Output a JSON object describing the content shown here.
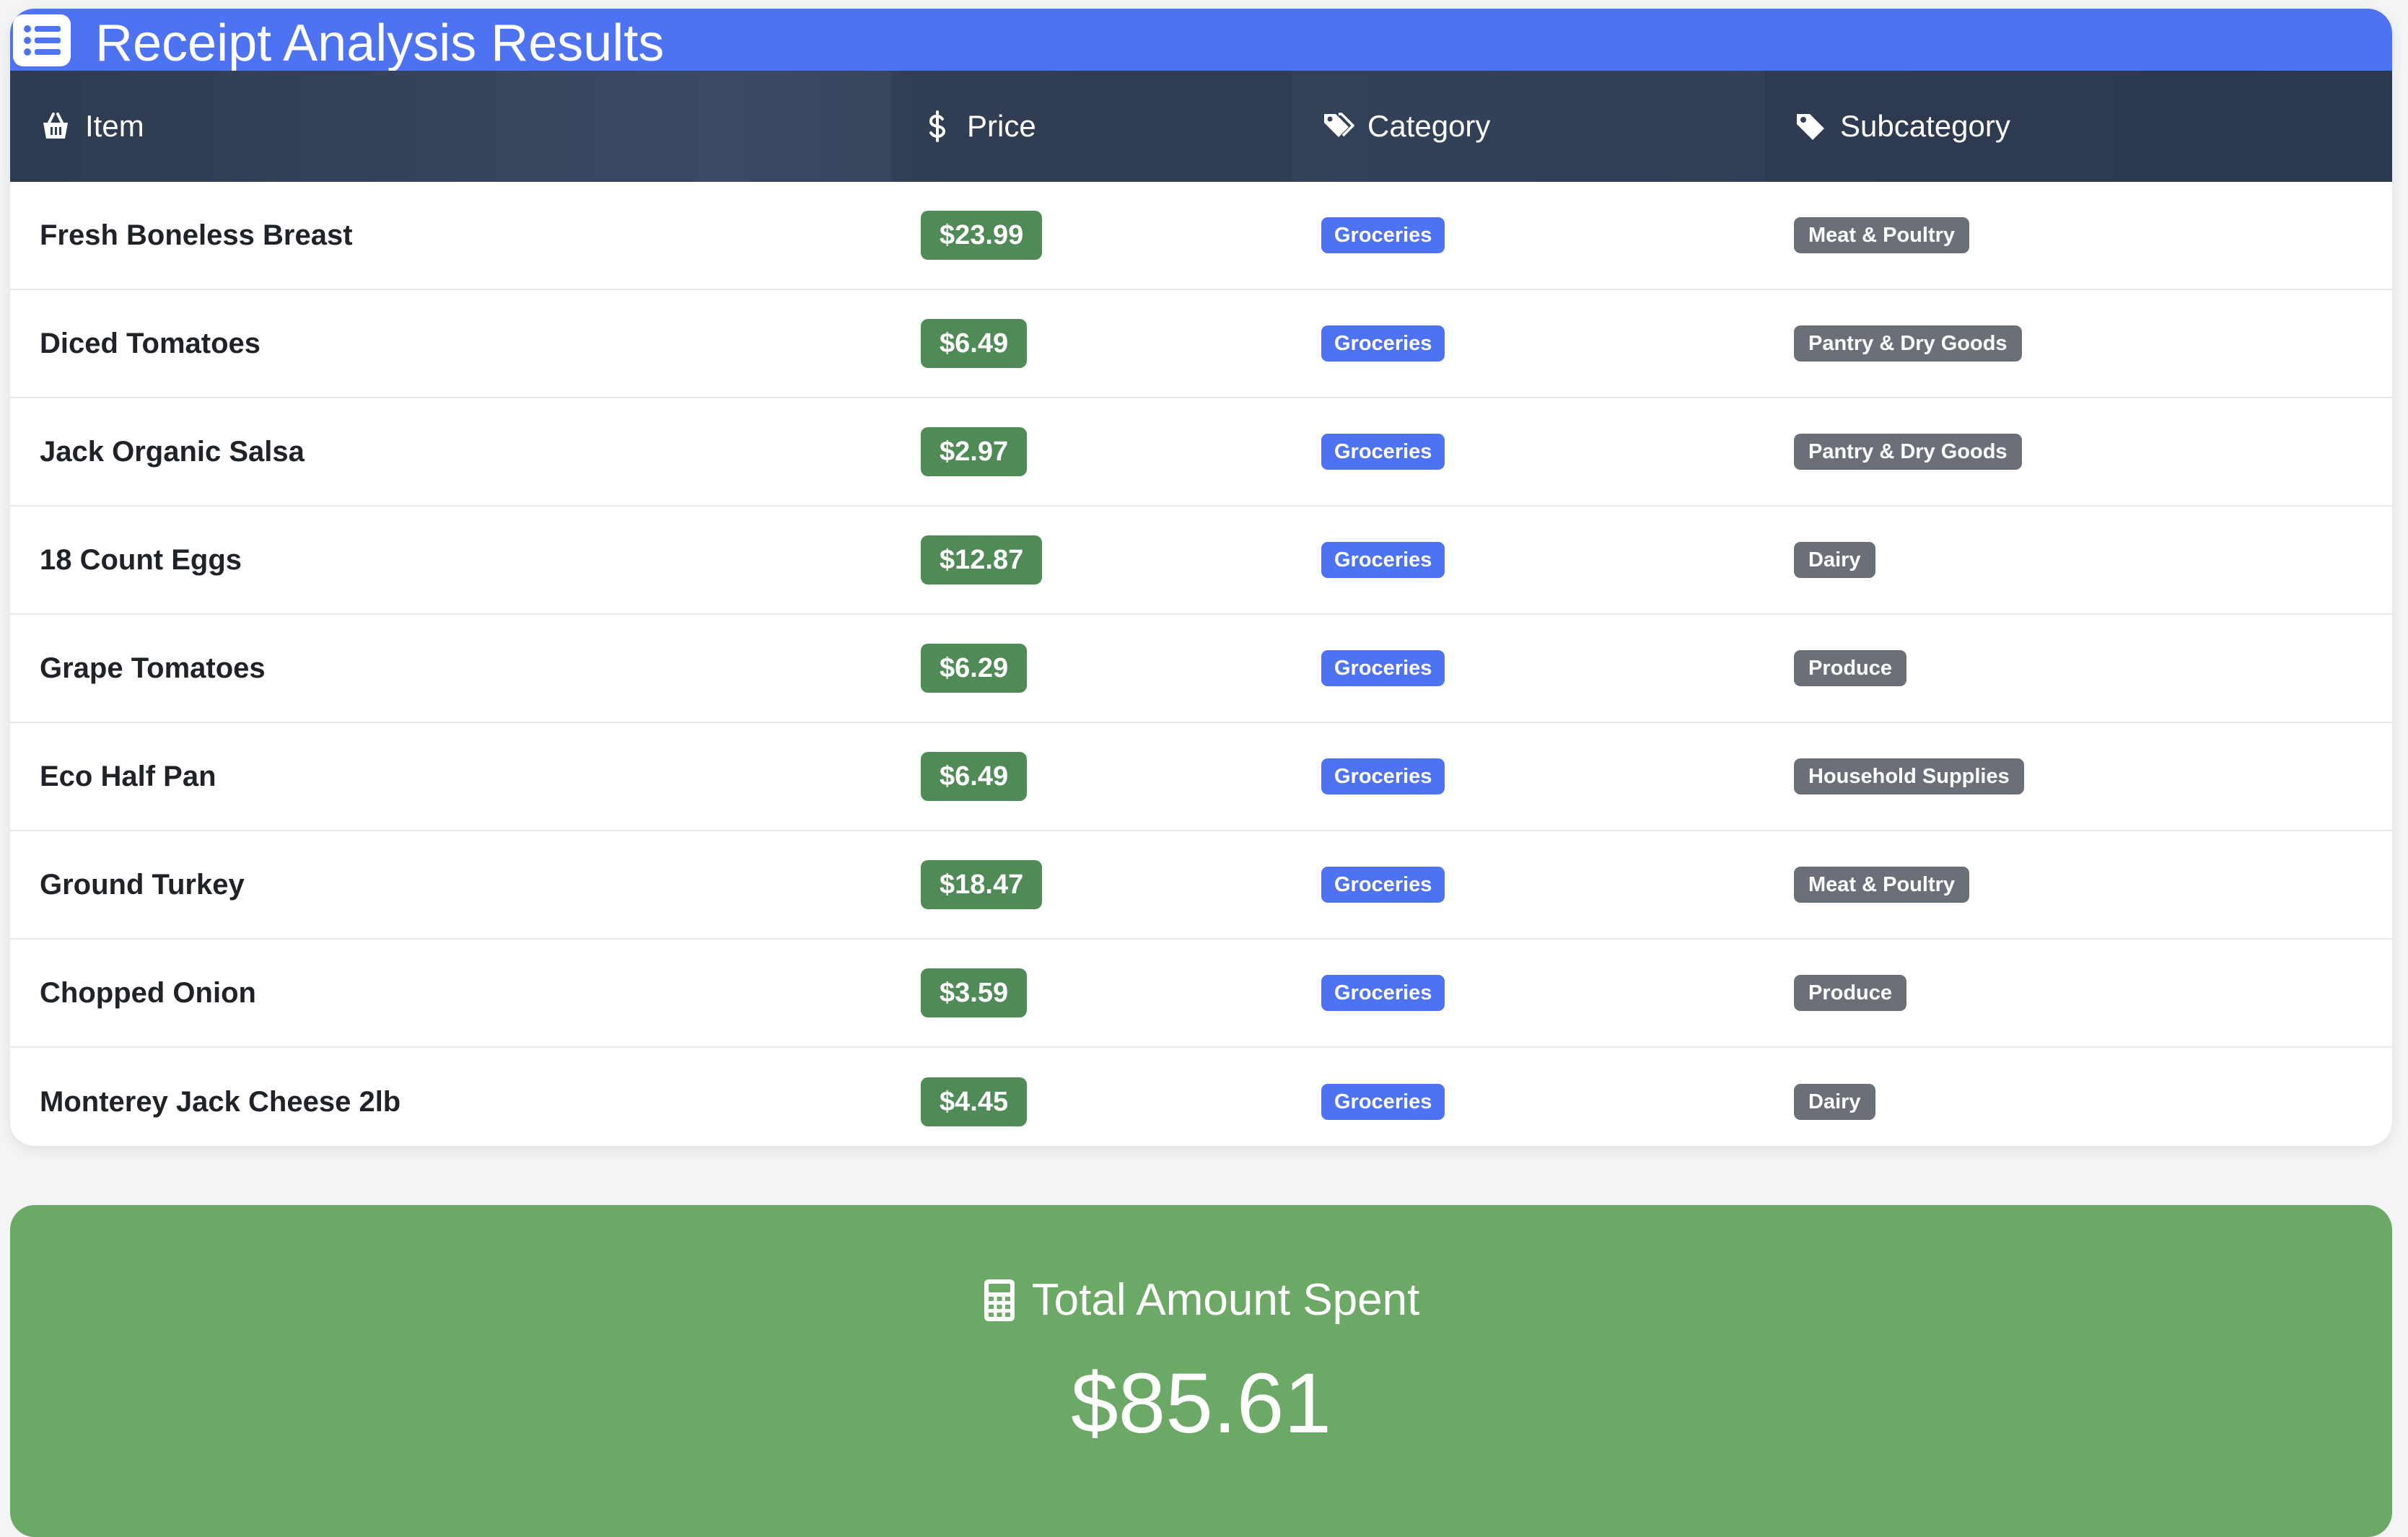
{
  "header": {
    "title": "Receipt Analysis Results",
    "icon": "list-icon"
  },
  "columns": {
    "item": {
      "label": "Item",
      "icon": "basket-icon"
    },
    "price": {
      "label": "Price",
      "icon": "dollar-icon"
    },
    "category": {
      "label": "Category",
      "icon": "tags-icon"
    },
    "subcategory": {
      "label": "Subcategory",
      "icon": "tag-icon"
    }
  },
  "rows": [
    {
      "item": "Fresh Boneless Breast",
      "price": "$23.99",
      "category": "Groceries",
      "subcategory": "Meat & Poultry"
    },
    {
      "item": "Diced Tomatoes",
      "price": "$6.49",
      "category": "Groceries",
      "subcategory": "Pantry & Dry Goods"
    },
    {
      "item": "Jack Organic Salsa",
      "price": "$2.97",
      "category": "Groceries",
      "subcategory": "Pantry & Dry Goods"
    },
    {
      "item": "18 Count Eggs",
      "price": "$12.87",
      "category": "Groceries",
      "subcategory": "Dairy"
    },
    {
      "item": "Grape Tomatoes",
      "price": "$6.29",
      "category": "Groceries",
      "subcategory": "Produce"
    },
    {
      "item": "Eco Half Pan",
      "price": "$6.49",
      "category": "Groceries",
      "subcategory": "Household Supplies"
    },
    {
      "item": "Ground Turkey",
      "price": "$18.47",
      "category": "Groceries",
      "subcategory": "Meat & Poultry"
    },
    {
      "item": "Chopped Onion",
      "price": "$3.59",
      "category": "Groceries",
      "subcategory": "Produce"
    },
    {
      "item": "Monterey Jack Cheese 2lb",
      "price": "$4.45",
      "category": "Groceries",
      "subcategory": "Dairy"
    }
  ],
  "total": {
    "label": "Total Amount Spent",
    "amount": "$85.61",
    "icon": "calculator-icon"
  },
  "colors": {
    "header_blue": "#4e73f2",
    "table_header_dark": "#334158",
    "price_green": "#4f8a57",
    "category_blue": "#4e73f2",
    "subcategory_gray": "#6b7078",
    "total_green": "#6ca966"
  }
}
